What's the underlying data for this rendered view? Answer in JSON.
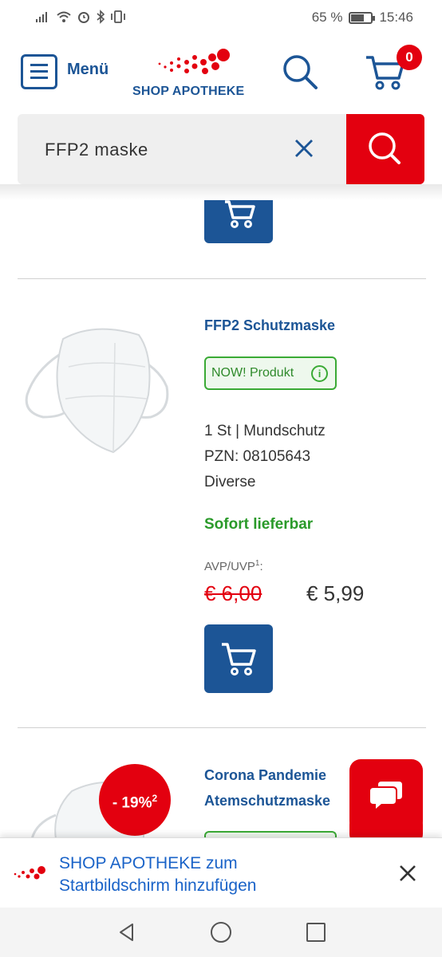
{
  "status_bar": {
    "battery": "65 %",
    "battery_level": 0.65,
    "time": "15:46"
  },
  "header": {
    "menu_label": "Menü",
    "logo_text": "SHOP APOTHEKE",
    "cart_count": "0"
  },
  "search": {
    "value": "FFP2 maske"
  },
  "product": {
    "title": "FFP2 Schutzmaske",
    "badge": "NOW! Produkt",
    "badge_info": "i",
    "quantity_category": "1 St | Mundschutz",
    "pzn": "PZN: 08105643",
    "brand": "Diverse",
    "availability": "Sofort lieferbar",
    "avp_label": "AVP/UVP",
    "avp_footnote": "1",
    "avp_colon": ":",
    "old_price": "€ 6,00",
    "price": "€ 5,99"
  },
  "next_product": {
    "title_line1": "Corona Pandemie",
    "title_line2": "Atemschutzmaske",
    "discount": "- 19%",
    "discount_footnote": "2"
  },
  "add_to_home": {
    "line1": "SHOP APOTHEKE zum",
    "line2": "Startbildschirm hinzufügen"
  },
  "colors": {
    "brand_blue": "#1c5596",
    "brand_red": "#e3000f",
    "available_green": "#2a9a2a",
    "link_blue": "#1a63c8"
  },
  "icons": [
    "signal-icon",
    "wifi-icon",
    "alarm-icon",
    "bluetooth-icon",
    "vibrate-icon",
    "battery-icon",
    "menu-icon",
    "search-icon",
    "cart-icon",
    "close-icon",
    "info-icon",
    "chat-icon",
    "back-icon",
    "home-icon",
    "recent-apps-icon"
  ]
}
